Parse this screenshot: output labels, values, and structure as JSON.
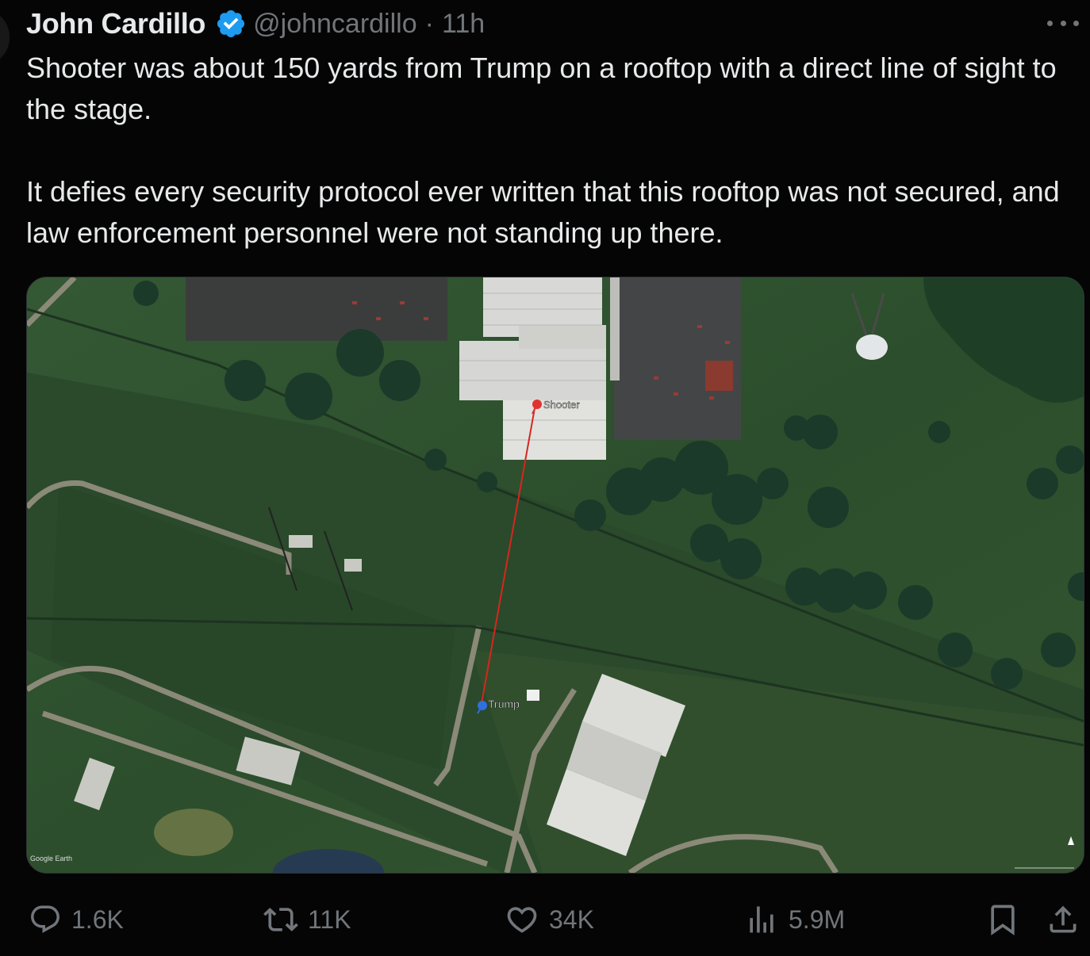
{
  "tweet": {
    "author_name": "John Cardillo",
    "handle": "@johncardillo",
    "separator": "·",
    "time": "11h",
    "paragraphs": [
      "Shooter was about 150 yards from Trump on a rooftop with a direct line of sight to the stage.",
      "It defies every security protocol ever written that this rooftop was not secured, and law enforcement personnel were not standing up there."
    ]
  },
  "media": {
    "type": "satellite-image",
    "labels": {
      "shooter": "Shooter",
      "trump": "Trump",
      "watermark": "Google Earth"
    },
    "colors": {
      "shooter_pin": "#e0322f",
      "trump_pin": "#2f6fe0",
      "line": "#d7261e"
    }
  },
  "actions": {
    "reply": {
      "icon": "reply-icon",
      "count": "1.6K"
    },
    "repost": {
      "icon": "repost-icon",
      "count": "11K"
    },
    "like": {
      "icon": "heart-icon",
      "count": "34K"
    },
    "views": {
      "icon": "views-icon",
      "count": "5.9M"
    },
    "bookmark": {
      "icon": "bookmark-icon"
    },
    "share": {
      "icon": "share-icon"
    }
  },
  "colors": {
    "background": "#050505",
    "text_primary": "#e7e9ea",
    "text_secondary": "#71767b",
    "verified_badge": "#1d9bf0"
  }
}
